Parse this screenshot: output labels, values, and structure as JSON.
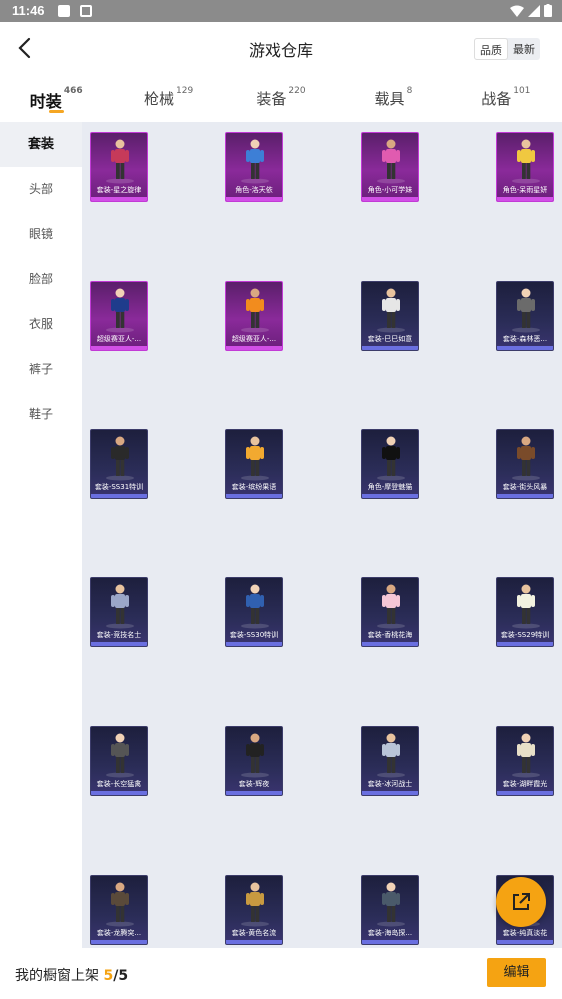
{
  "status_bar": {
    "time": "11:46"
  },
  "header": {
    "title": "游戏仓库",
    "sort_options": [
      "品质",
      "最新"
    ]
  },
  "tabs": [
    {
      "label": "时装",
      "count": "466"
    },
    {
      "label": "枪械",
      "count": "129"
    },
    {
      "label": "装备",
      "count": "220"
    },
    {
      "label": "载具",
      "count": "8"
    },
    {
      "label": "战备",
      "count": "101"
    }
  ],
  "sidebar": {
    "items": [
      "套装",
      "头部",
      "眼镜",
      "脸部",
      "衣服",
      "裤子",
      "鞋子"
    ]
  },
  "items": [
    {
      "label": "套装-星之旋律",
      "rarity": "purple"
    },
    {
      "label": "角色-洛天依",
      "rarity": "purple"
    },
    {
      "label": "角色-小可学妹",
      "rarity": "purple"
    },
    {
      "label": "角色-呆雨星妍",
      "rarity": "purple"
    },
    {
      "label": "超级赛亚人-...",
      "rarity": "purple"
    },
    {
      "label": "超级赛亚人-...",
      "rarity": "purple"
    },
    {
      "label": "套装-巳巳如意",
      "rarity": "blue"
    },
    {
      "label": "套装-森林恶...",
      "rarity": "blue"
    },
    {
      "label": "套装-SS31特训",
      "rarity": "blue"
    },
    {
      "label": "套装-缤纷果语",
      "rarity": "blue"
    },
    {
      "label": "角色-摩登魅猫",
      "rarity": "blue"
    },
    {
      "label": "套装-街头风暴",
      "rarity": "blue"
    },
    {
      "label": "套装-竞技名士",
      "rarity": "blue"
    },
    {
      "label": "套装-SS30特训",
      "rarity": "blue"
    },
    {
      "label": "套装-香桃花海",
      "rarity": "blue"
    },
    {
      "label": "套装-SS29特训",
      "rarity": "blue"
    },
    {
      "label": "套装-长空猛禽",
      "rarity": "blue"
    },
    {
      "label": "套装-辉夜",
      "rarity": "blue"
    },
    {
      "label": "套装-冰河战士",
      "rarity": "blue"
    },
    {
      "label": "套装-湖畔霞光",
      "rarity": "blue"
    },
    {
      "label": "套装-龙腾突...",
      "rarity": "blue"
    },
    {
      "label": "套装-黄色名流",
      "rarity": "blue"
    },
    {
      "label": "套装-海岛探...",
      "rarity": "blue"
    },
    {
      "label": "套装-纯真淡花",
      "rarity": "blue"
    }
  ],
  "bottom": {
    "prefix": "我的橱窗上架",
    "count": "5",
    "separator": "/",
    "total": "5",
    "edit_label": "编辑"
  },
  "colors": {
    "accent": "#f5a312",
    "purple_frame": "#c23ad6",
    "blue_frame": "#6a6fe0"
  }
}
